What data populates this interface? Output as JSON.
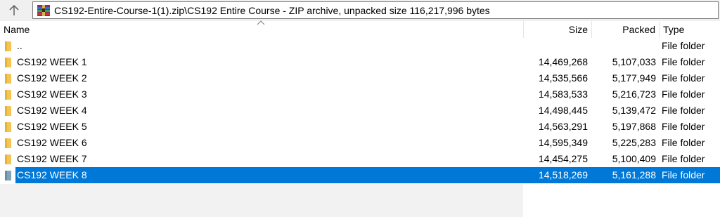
{
  "address": {
    "path": "CS192-Entire-Course-1(1).zip\\CS192 Entire Course - ZIP archive, unpacked size 116,217,996 bytes"
  },
  "icons": {
    "up": "up-arrow-icon",
    "archive": "winrar-archive-icon",
    "folder": "folder-icon",
    "sort": "sort-ascending-icon"
  },
  "colors": {
    "selection": "#0078d7",
    "folder": "#f4c552"
  },
  "columns": {
    "name": "Name",
    "size": "Size",
    "packed": "Packed",
    "type": "Type"
  },
  "rows": [
    {
      "name": "..",
      "size": "",
      "packed": "",
      "type": "File folder",
      "selected": false
    },
    {
      "name": "CS192 WEEK 1",
      "size": "14,469,268",
      "packed": "5,107,033",
      "type": "File folder",
      "selected": false
    },
    {
      "name": "CS192 WEEK 2",
      "size": "14,535,566",
      "packed": "5,177,949",
      "type": "File folder",
      "selected": false
    },
    {
      "name": "CS192 WEEK 3",
      "size": "14,583,533",
      "packed": "5,216,723",
      "type": "File folder",
      "selected": false
    },
    {
      "name": "CS192 WEEK 4",
      "size": "14,498,445",
      "packed": "5,139,472",
      "type": "File folder",
      "selected": false
    },
    {
      "name": "CS192 WEEK 5",
      "size": "14,563,291",
      "packed": "5,197,868",
      "type": "File folder",
      "selected": false
    },
    {
      "name": "CS192 WEEK 6",
      "size": "14,595,349",
      "packed": "5,225,283",
      "type": "File folder",
      "selected": false
    },
    {
      "name": "CS192 WEEK 7",
      "size": "14,454,275",
      "packed": "5,100,409",
      "type": "File folder",
      "selected": false
    },
    {
      "name": "CS192 WEEK 8",
      "size": "14,518,269",
      "packed": "5,161,288",
      "type": "File folder",
      "selected": true
    }
  ]
}
